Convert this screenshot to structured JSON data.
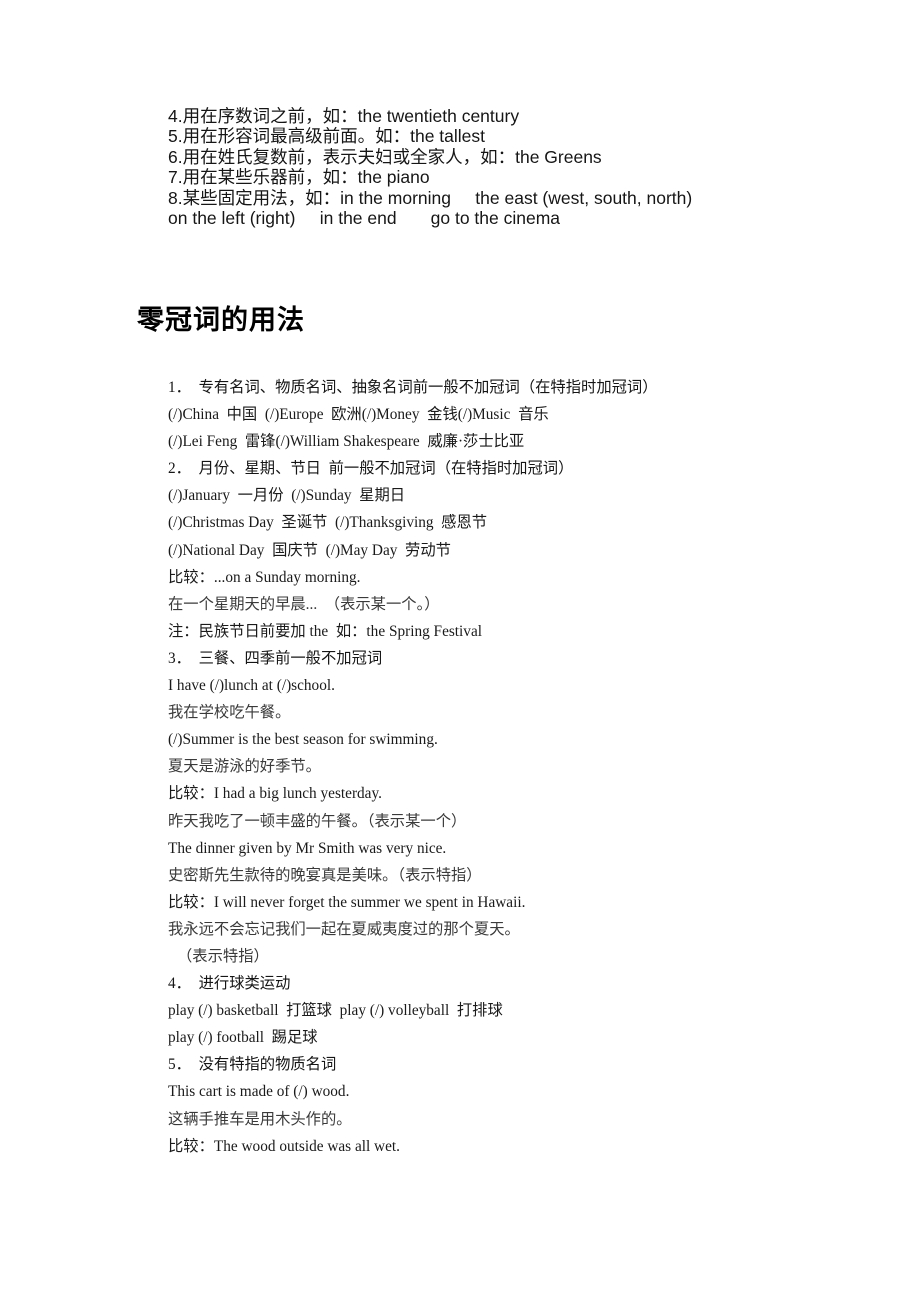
{
  "document": {
    "top_section": {
      "lines": [
        "4.用在序数词之前，如：the twentieth century",
        "5.用在形容词最高级前面。如：the tallest",
        "6.用在姓氏复数前，表示夫妇或全家人，如：the Greens",
        "7.用在某些乐器前，如：the piano",
        "8.某些固定用法，如：in the morning     the east (west, south, north)",
        "on the left (right)     in the end       go to the cinema"
      ]
    },
    "heading": "零冠词的用法",
    "body": {
      "lines": [
        {
          "text": "1．  专有名词、物质名词、抽象名词前一般不加冠词（在特指时加冠词）",
          "style": "num"
        },
        {
          "text": "(/)China  中国  (/)Europe  欧洲(/)Money  金钱(/)Music  音乐",
          "style": "plain"
        },
        {
          "text": "(/)Lei Feng  雷锋(/)William Shakespeare  威廉·莎士比亚",
          "style": "plain"
        },
        {
          "text": "2．  月份、星期、节日  前一般不加冠词（在特指时加冠词）",
          "style": "num"
        },
        {
          "text": "(/)January  一月份  (/)Sunday  星期日",
          "style": "plain"
        },
        {
          "text": "(/)Christmas Day  圣诞节  (/)Thanksgiving  感恩节",
          "style": "plain"
        },
        {
          "text": "(/)National Day  国庆节  (/)May Day  劳动节",
          "style": "plain"
        },
        {
          "text": "比较：...on a Sunday morning.",
          "style": "plain"
        },
        {
          "text": "在一个星期天的早晨...  （表示某一个。）",
          "style": "cn"
        },
        {
          "text": "注：民族节日前要加 the  如：the Spring Festival",
          "style": "plain"
        },
        {
          "text": "3．  三餐、四季前一般不加冠词",
          "style": "num"
        },
        {
          "text": "I have (/)lunch at (/)school.",
          "style": "plain"
        },
        {
          "text": "我在学校吃午餐。",
          "style": "cn"
        },
        {
          "text": "(/)Summer is the best season for swimming.",
          "style": "plain"
        },
        {
          "text": "夏天是游泳的好季节。",
          "style": "cn"
        },
        {
          "text": "比较：I had a big lunch yesterday.",
          "style": "plain"
        },
        {
          "text": "昨天我吃了一顿丰盛的午餐。（表示某一个）",
          "style": "cn"
        },
        {
          "text": "The dinner given by Mr Smith was very nice.",
          "style": "plain"
        },
        {
          "text": "史密斯先生款待的晚宴真是美味。（表示特指）",
          "style": "cn"
        },
        {
          "text": "比较：I will never forget the summer we spent in Hawaii.",
          "style": "plain"
        },
        {
          "text": "我永远不会忘记我们一起在夏威夷度过的那个夏天。",
          "style": "cn"
        },
        {
          "text": "（表示特指）",
          "style": "cn indent"
        },
        {
          "text": "4．  进行球类运动",
          "style": "num"
        },
        {
          "text": "play (/) basketball  打篮球  play (/) volleyball  打排球",
          "style": "plain"
        },
        {
          "text": "play (/) football  踢足球",
          "style": "plain"
        },
        {
          "text": "5．  没有特指的物质名词",
          "style": "num"
        },
        {
          "text": "This cart is made of (/) wood.",
          "style": "plain"
        },
        {
          "text": "这辆手推车是用木头作的。",
          "style": "cn"
        },
        {
          "text": "比较：The wood outside was all wet.",
          "style": "plain"
        }
      ]
    }
  }
}
